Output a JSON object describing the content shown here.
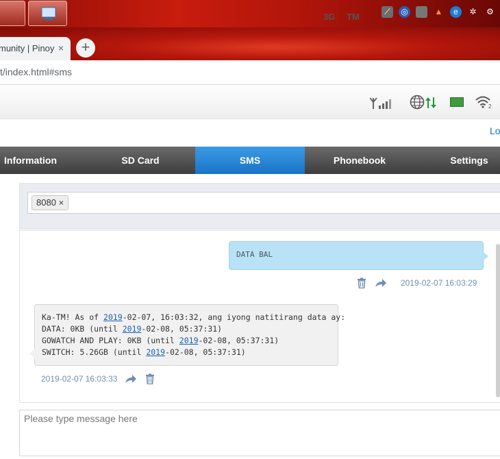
{
  "browser": {
    "tab_title": "munity | Pinoy",
    "tab_close": "×",
    "new_tab": "+",
    "address": "t/index.html#sms"
  },
  "status": {
    "network_type": "3G",
    "carrier": "TM",
    "wifi_clients": "2"
  },
  "logout_label": "Lo",
  "nav": {
    "items": [
      {
        "label": "Information"
      },
      {
        "label": "SD Card"
      },
      {
        "label": "SMS"
      },
      {
        "label": "Phonebook"
      },
      {
        "label": "Settings"
      }
    ],
    "active": "SMS"
  },
  "sms": {
    "recipient": "8080",
    "recipient_remove": "×",
    "messages": [
      {
        "direction": "outgoing",
        "text": "DATA BAL",
        "timestamp": "2019-02-07 16:03:29"
      },
      {
        "direction": "incoming",
        "lines": [
          {
            "pre": "Ka-TM! As of ",
            "link": "2019",
            "post": "-02-07, 16:03:32, ang iyong natitirang data ay:"
          },
          {
            "pre": "DATA: 0KB (until ",
            "link": "2019",
            "post": "-02-08, 05:37:31)"
          },
          {
            "pre": "GOWATCH AND PLAY: 0KB (until ",
            "link": "2019",
            "post": "-02-08, 05:37:31)"
          },
          {
            "pre": "SWITCH: 5.26GB (until ",
            "link": "2019",
            "post": "-02-08, 05:37:31)"
          }
        ],
        "timestamp": "2019-02-07 16:03:33"
      }
    ],
    "compose_placeholder": "Please type message here"
  },
  "colors": {
    "nav_active": "#1a73c8",
    "outgoing_bubble": "#b9e2f6",
    "incoming_bubble": "#f1f1f1",
    "timestamp": "#6f8fb0"
  }
}
